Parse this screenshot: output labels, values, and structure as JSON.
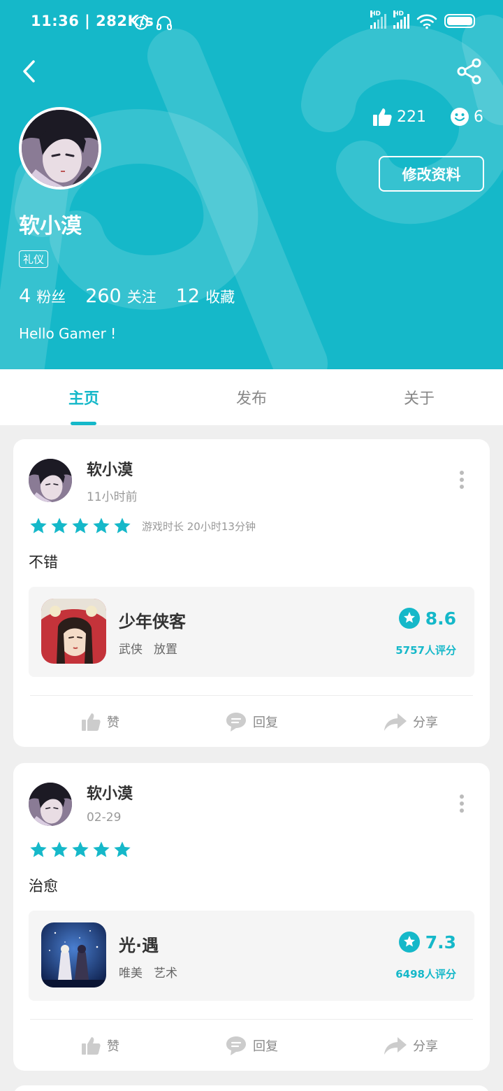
{
  "status_bar": {
    "time": "11:36 | 282K/s",
    "signal_label_1": "HD",
    "signal_label_2": "HD"
  },
  "profile": {
    "username": "软小漠",
    "tag": "礼仪",
    "likes": "221",
    "smiles": "6",
    "edit_label": "修改资料",
    "followers_count": "4",
    "followers_label": "粉丝",
    "following_count": "260",
    "following_label": "关注",
    "favorites_count": "12",
    "favorites_label": "收藏",
    "bio": "Hello Gamer !"
  },
  "tabs": [
    {
      "label": "主页",
      "active": true
    },
    {
      "label": "发布",
      "active": false
    },
    {
      "label": "关于",
      "active": false
    }
  ],
  "posts": [
    {
      "author": "软小漠",
      "time": "11小时前",
      "rating": 5,
      "playtime": "游戏时长 20小时13分钟",
      "content": "不错",
      "game": {
        "name": "少年侠客",
        "tags": [
          "武侠",
          "放置"
        ],
        "score": "8.6",
        "raters": "5757人评分"
      },
      "actions": {
        "like": "赞",
        "reply": "回复",
        "share": "分享"
      }
    },
    {
      "author": "软小漠",
      "time": "02-29",
      "rating": 5,
      "playtime": "",
      "content": "治愈",
      "game": {
        "name": "光·遇",
        "tags": [
          "唯美",
          "艺术"
        ],
        "score": "7.3",
        "raters": "6498人评分"
      },
      "actions": {
        "like": "赞",
        "reply": "回复",
        "share": "分享"
      }
    }
  ],
  "colors": {
    "accent": "#15b8c9",
    "background": "#efefef",
    "card": "#ffffff"
  },
  "icons": [
    "back-icon",
    "share-icon",
    "thumb-up-icon",
    "smile-icon",
    "more-icon",
    "star-icon",
    "comment-icon",
    "forward-icon",
    "alarm-icon",
    "headphone-icon",
    "wifi-icon",
    "battery-icon"
  ]
}
